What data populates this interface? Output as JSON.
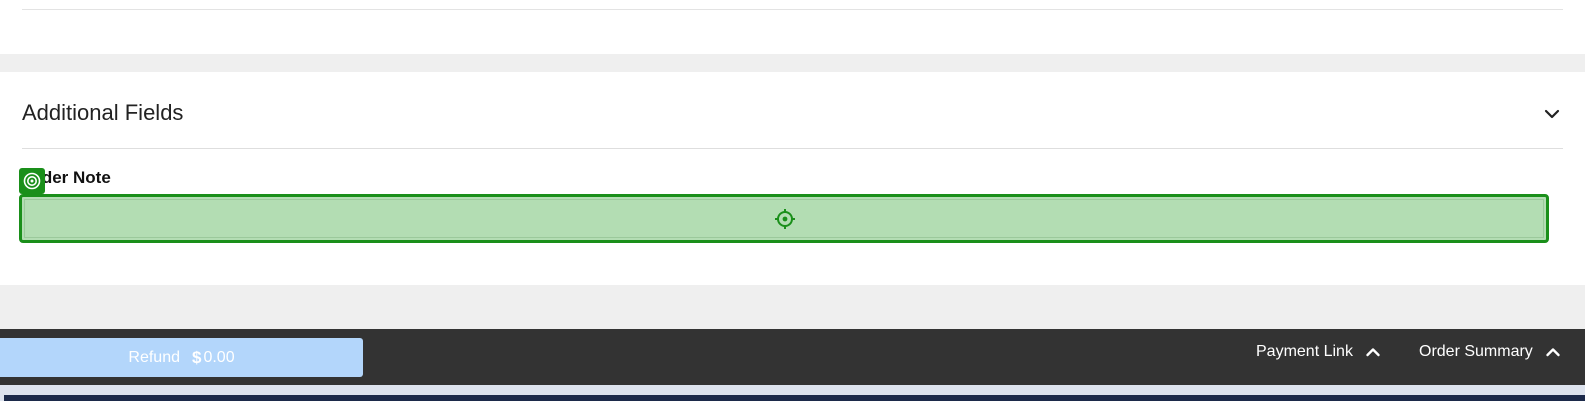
{
  "additional_fields": {
    "title": "Additional Fields",
    "chevron_icon": "chevron-down-icon"
  },
  "order_note": {
    "label": "Order Note",
    "visible_label": "der Note",
    "value": "",
    "badge_icon": "target-icon",
    "crosshair_icon": "crosshair-icon"
  },
  "bottom_bar": {
    "refund": {
      "label": "Refund",
      "currency": "$",
      "amount": "0.00"
    },
    "payment_link": {
      "label": "Payment Link",
      "icon": "chevron-up-icon"
    },
    "order_summary": {
      "label": "Order Summary",
      "icon": "chevron-up-icon"
    }
  },
  "colors": {
    "highlight_green": "#1a8f1a",
    "field_fill": "#b3ddb3",
    "refund_button": "#b3d6fb",
    "bottom_bar": "#333333"
  }
}
